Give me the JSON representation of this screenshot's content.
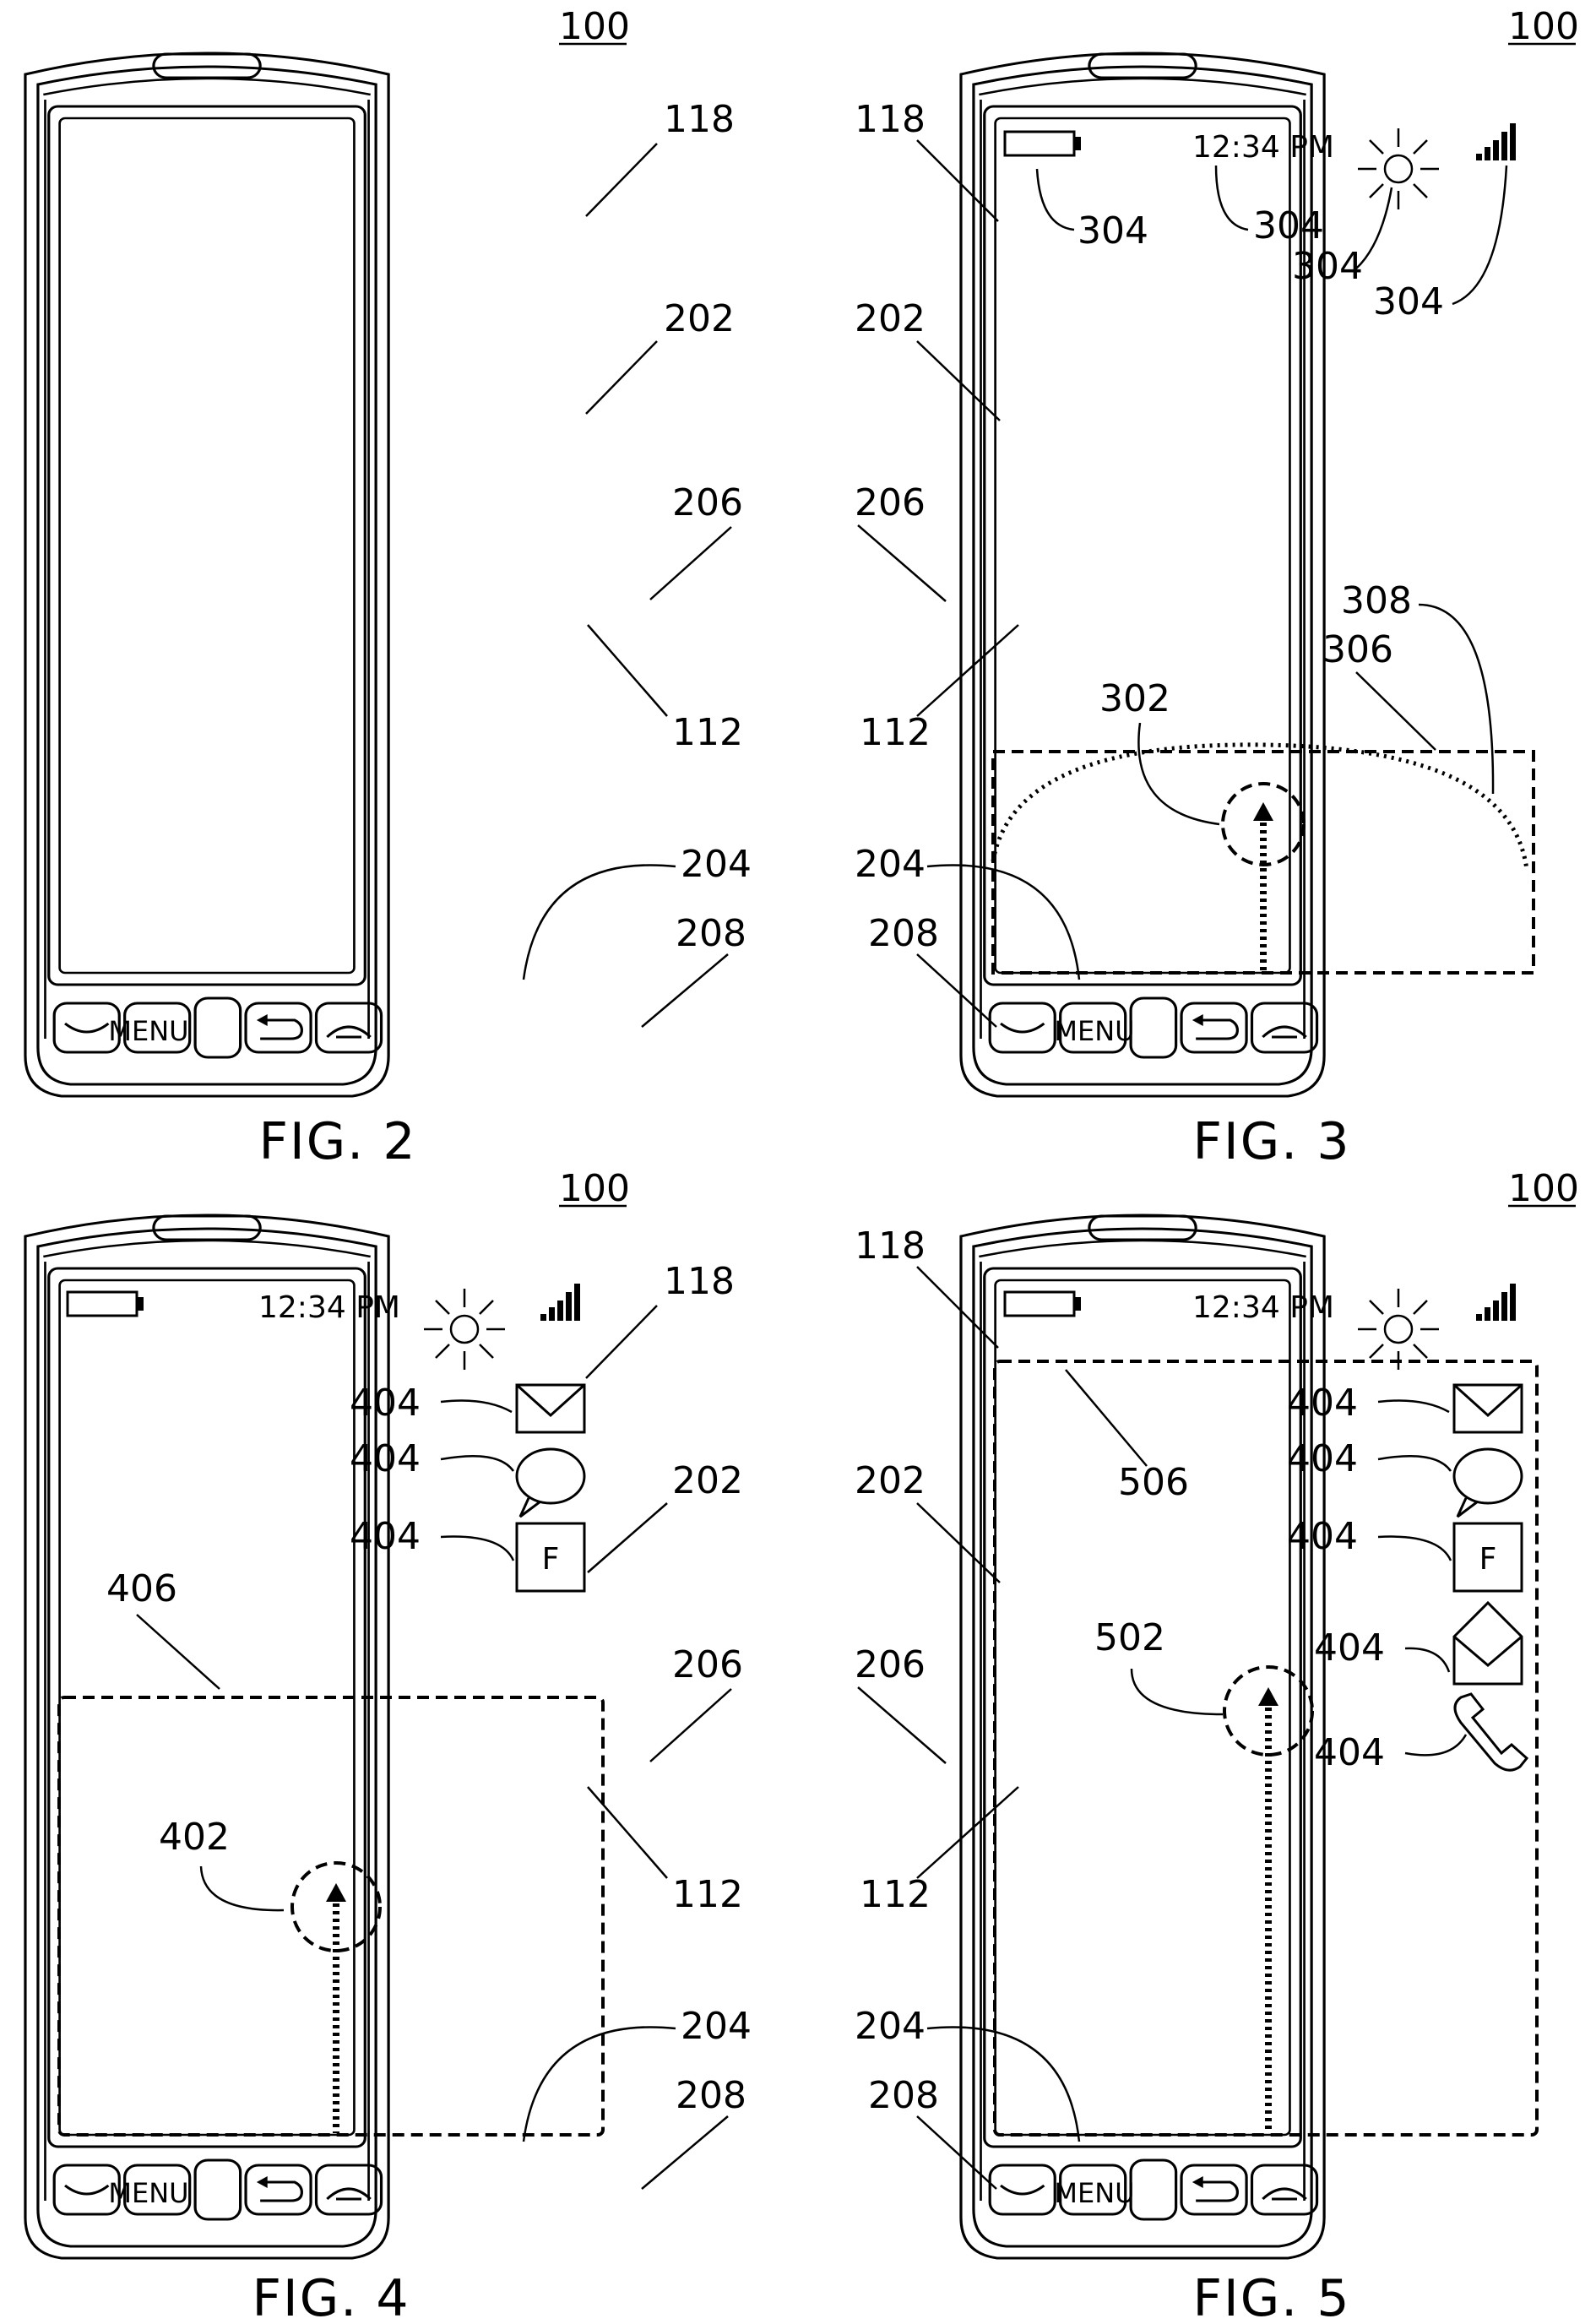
{
  "figures": {
    "fig2": {
      "caption": "FIG. 2",
      "ref_device": "100",
      "labels": {
        "r118": "118",
        "r202": "202",
        "r206": "206",
        "r112": "112",
        "r204": "204",
        "r208": "208"
      },
      "menu_label": "MENU"
    },
    "fig3": {
      "caption": "FIG. 3",
      "ref_device": "100",
      "status_time": "12:34 PM",
      "labels": {
        "r118": "118",
        "r202": "202",
        "r206": "206",
        "r112": "112",
        "r204": "204",
        "r208": "208",
        "r304a": "304",
        "r304b": "304",
        "r304c": "304",
        "r304d": "304",
        "r308": "308",
        "r306": "306",
        "r302": "302"
      },
      "menu_label": "MENU"
    },
    "fig4": {
      "caption": "FIG. 4",
      "ref_device": "100",
      "status_time": "12:34 PM",
      "labels": {
        "r118": "118",
        "r404a": "404",
        "r404b": "404",
        "r404c": "404",
        "r202": "202",
        "r406": "406",
        "r206": "206",
        "r402": "402",
        "r112": "112",
        "r204": "204",
        "r208": "208"
      },
      "facebook_letter": "F",
      "menu_label": "MENU"
    },
    "fig5": {
      "caption": "FIG. 5",
      "ref_device": "100",
      "status_time": "12:34 PM",
      "labels": {
        "r118": "118",
        "r404a": "404",
        "r404b": "404",
        "r506": "506",
        "r404c": "404",
        "r202": "202",
        "r502": "502",
        "r404d": "404",
        "r206": "206",
        "r404e": "404",
        "r112": "112",
        "r204": "204",
        "r208": "208"
      },
      "facebook_letter": "F",
      "menu_label": "MENU"
    }
  },
  "icons": [
    "battery-icon",
    "clock-text",
    "sun-icon",
    "signal-icon",
    "envelope-icon",
    "speech-bubble-icon",
    "facebook-icon",
    "open-envelope-icon",
    "phone-handset-icon",
    "send-key-icon",
    "back-key-icon",
    "end-key-icon",
    "trackpad"
  ],
  "colors": {
    "ink": "#000000",
    "paper": "#ffffff"
  }
}
